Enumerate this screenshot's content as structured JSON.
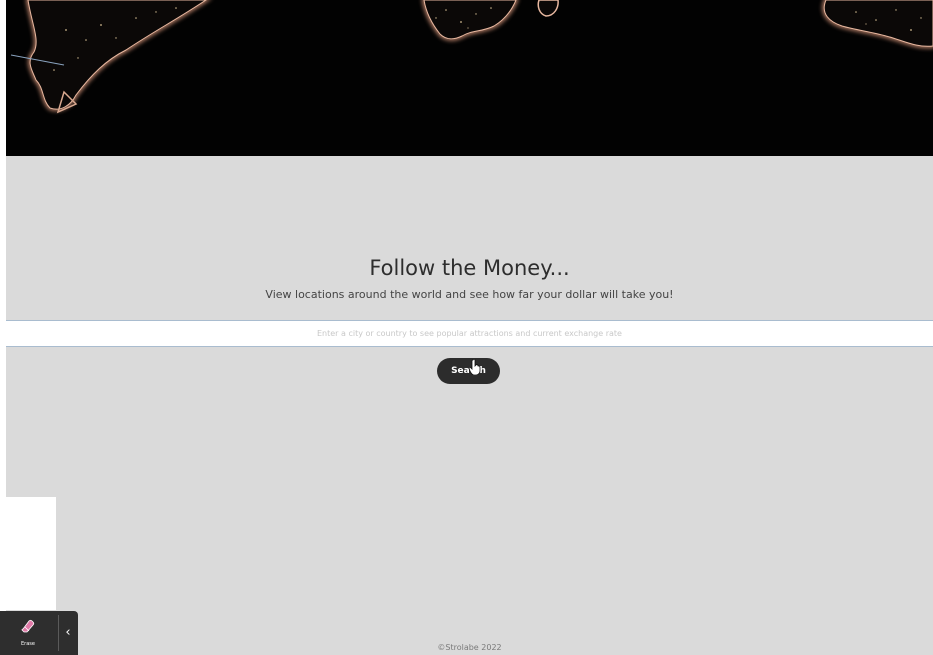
{
  "hero": {
    "image": "world-at-night-map"
  },
  "main": {
    "heading": "Follow the Money...",
    "subheading": "View locations around the world and see how far your dollar will take you!",
    "search_placeholder": "Enter a city or country to see popular attractions and current exchange rate",
    "search_button_label": "Search"
  },
  "footer": {
    "copyright": "©Strolabe 2022"
  },
  "toolbar": {
    "erase_label": "Erase",
    "erase_icon": "eraser-icon",
    "collapse_icon": "chevron-left-icon"
  },
  "colors": {
    "page_background": "#dadada",
    "hero_background": "#020202",
    "button_background": "#2c2c2c",
    "toolbar_background": "#2e2e2e"
  }
}
